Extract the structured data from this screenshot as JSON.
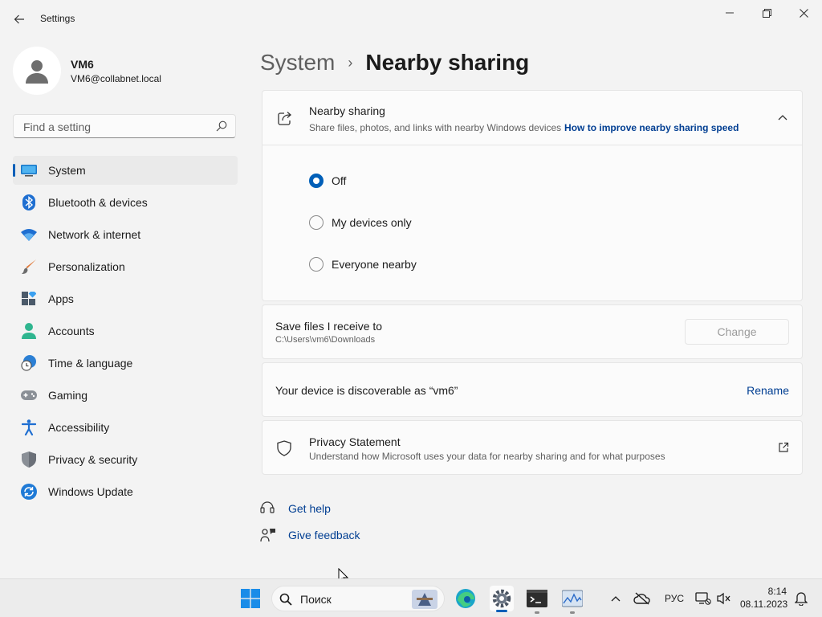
{
  "window": {
    "title": "Settings"
  },
  "user": {
    "name": "VM6",
    "email": "VM6@collabnet.local"
  },
  "search": {
    "placeholder": "Find a setting"
  },
  "sidebar": {
    "items": [
      {
        "label": "System",
        "icon": "system-icon",
        "selected": true
      },
      {
        "label": "Bluetooth & devices",
        "icon": "bluetooth-icon"
      },
      {
        "label": "Network & internet",
        "icon": "wifi-icon"
      },
      {
        "label": "Personalization",
        "icon": "brush-icon"
      },
      {
        "label": "Apps",
        "icon": "apps-icon"
      },
      {
        "label": "Accounts",
        "icon": "accounts-icon"
      },
      {
        "label": "Time & language",
        "icon": "globe-clock-icon"
      },
      {
        "label": "Gaming",
        "icon": "gamepad-icon"
      },
      {
        "label": "Accessibility",
        "icon": "accessibility-icon"
      },
      {
        "label": "Privacy & security",
        "icon": "shield-icon"
      },
      {
        "label": "Windows Update",
        "icon": "update-icon"
      }
    ]
  },
  "breadcrumb": {
    "parent": "System",
    "separator": "›",
    "current": "Nearby sharing"
  },
  "nearby": {
    "title": "Nearby sharing",
    "subtitle": "Share files, photos, and links with nearby Windows devices",
    "link": "How to improve nearby sharing speed",
    "options": [
      {
        "label": "Off",
        "checked": true
      },
      {
        "label": "My devices only",
        "checked": false
      },
      {
        "label": "Everyone nearby",
        "checked": false
      }
    ]
  },
  "save_files": {
    "title": "Save files I receive to",
    "path": "C:\\Users\\vm6\\Downloads",
    "button": "Change"
  },
  "discoverable": {
    "text": "Your device is discoverable as “vm6”",
    "action": "Rename"
  },
  "privacy": {
    "title": "Privacy Statement",
    "subtitle": "Understand how Microsoft uses your data for nearby sharing and for what purposes"
  },
  "help": {
    "get_help": "Get help",
    "give_feedback": "Give feedback"
  },
  "taskbar": {
    "search_label": "Поиск",
    "language": "РУС",
    "time": "8:14",
    "date": "08.11.2023"
  },
  "colors": {
    "accent": "#005fb8",
    "link": "#003e92",
    "background": "#f3f3f3",
    "card": "#fbfbfb"
  }
}
